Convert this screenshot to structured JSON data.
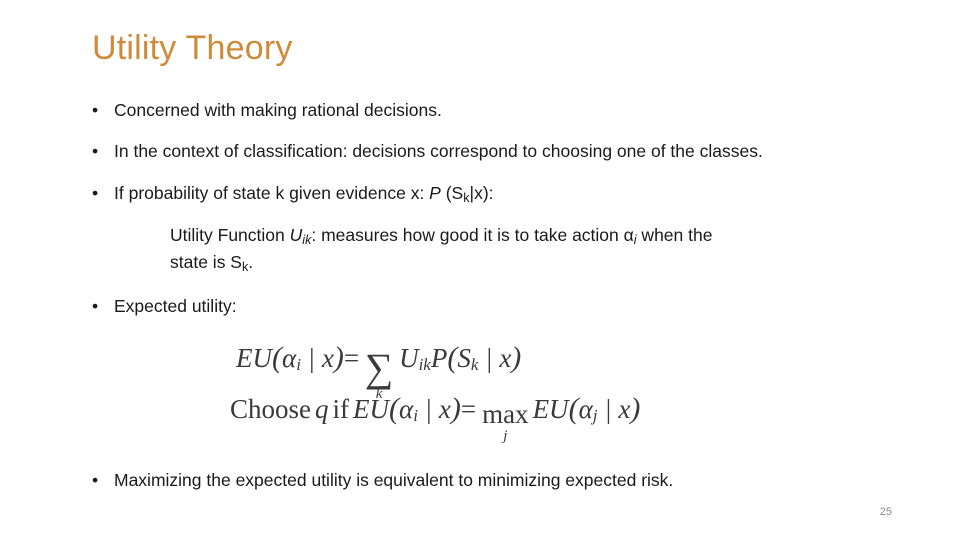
{
  "slide": {
    "title": "Utility Theory",
    "page_number": "25",
    "bullet_marker": "•",
    "bullets": [
      {
        "text": "Concerned with making rational decisions."
      },
      {
        "text": "In the context of classification: decisions correspond to choosing one of the classes."
      },
      {
        "text_pre": "If probability of state k given evidence x: ",
        "math_p": "P",
        "math_open": " (S",
        "math_sub": "k",
        "math_close": "|x):"
      },
      {
        "text": "Expected utility:"
      }
    ],
    "indent": {
      "line1_pre": "Utility Function ",
      "line1_u": "U",
      "line1_u_sub": "ik",
      "line1_mid": ": measures how good it is to take action ",
      "line1_alpha": "α",
      "line1_alpha_sub": "i",
      "line1_post": " when the",
      "line2_pre": "state is S",
      "line2_sub": "k",
      "line2_post": "."
    },
    "equations": {
      "line1": {
        "eu": "EU",
        "open": "(",
        "alpha": "α",
        "alpha_sub": "i",
        "bar_x": " | x",
        "close": ")",
        "equals": "=",
        "sigma": "∑",
        "sigma_sub": "k",
        "u": "U",
        "u_sub": "ik",
        "p": "P",
        "p_open": "(",
        "s": "S",
        "s_sub": "k",
        "p_bar_x": " | x",
        "p_close": ")"
      },
      "line2": {
        "choose": "Choose",
        "q": "q",
        "if": "if",
        "eu": "EU",
        "open": "(",
        "alpha": "α",
        "alpha_sub": "i",
        "bar_x": " | x",
        "close": ")",
        "equals": "=",
        "max": "max",
        "max_sub": "j",
        "eu2": "EU",
        "open2": "(",
        "alpha2": "α",
        "alpha2_sub": "j",
        "bar_x2": " | x",
        "close2": ")"
      }
    },
    "last_bullet": "Maximizing the expected utility is equivalent to minimizing expected risk."
  }
}
